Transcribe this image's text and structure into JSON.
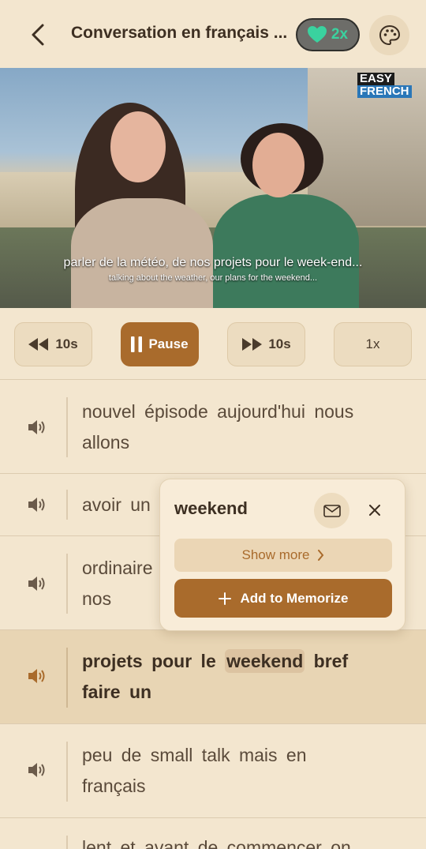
{
  "header": {
    "title": "Conversation en français ...",
    "streak_multiplier": "2x",
    "back_icon": "chevron-left-icon",
    "streak_icon": "heart-icon",
    "theme_icon": "palette-icon"
  },
  "video": {
    "logo_line1": "EASY",
    "logo_line2": "FRENCH",
    "subtitle": "parler de la météo, de nos projets pour le week-end...",
    "subtitle_translation": "talking about the weather, our plans for the weekend..."
  },
  "controls": {
    "rewind_label": "10s",
    "pause_label": "Pause",
    "forward_label": "10s",
    "speed_label": "1x"
  },
  "transcript": {
    "lines": [
      {
        "line1": "nouvel épisode aujourd'hui nous",
        "line2": "allons"
      },
      {
        "line1": "avoir un",
        "line2": ""
      },
      {
        "line1": "ordinaire",
        "line2": "nos"
      },
      {
        "before": "projets pour le ",
        "word": "weekend",
        "after": " bref",
        "line2": "faire un"
      },
      {
        "line1": "peu de small talk mais en",
        "line2": "français"
      },
      {
        "line1": "lent et avant de commencer on",
        "line2": ""
      }
    ]
  },
  "popup": {
    "word": "weekend",
    "show_more_label": "Show more",
    "add_label": "Add to Memorize"
  },
  "colors": {
    "background": "#f3e6cf",
    "accent": "#a96b2c",
    "streak_green": "#3ad29f"
  }
}
